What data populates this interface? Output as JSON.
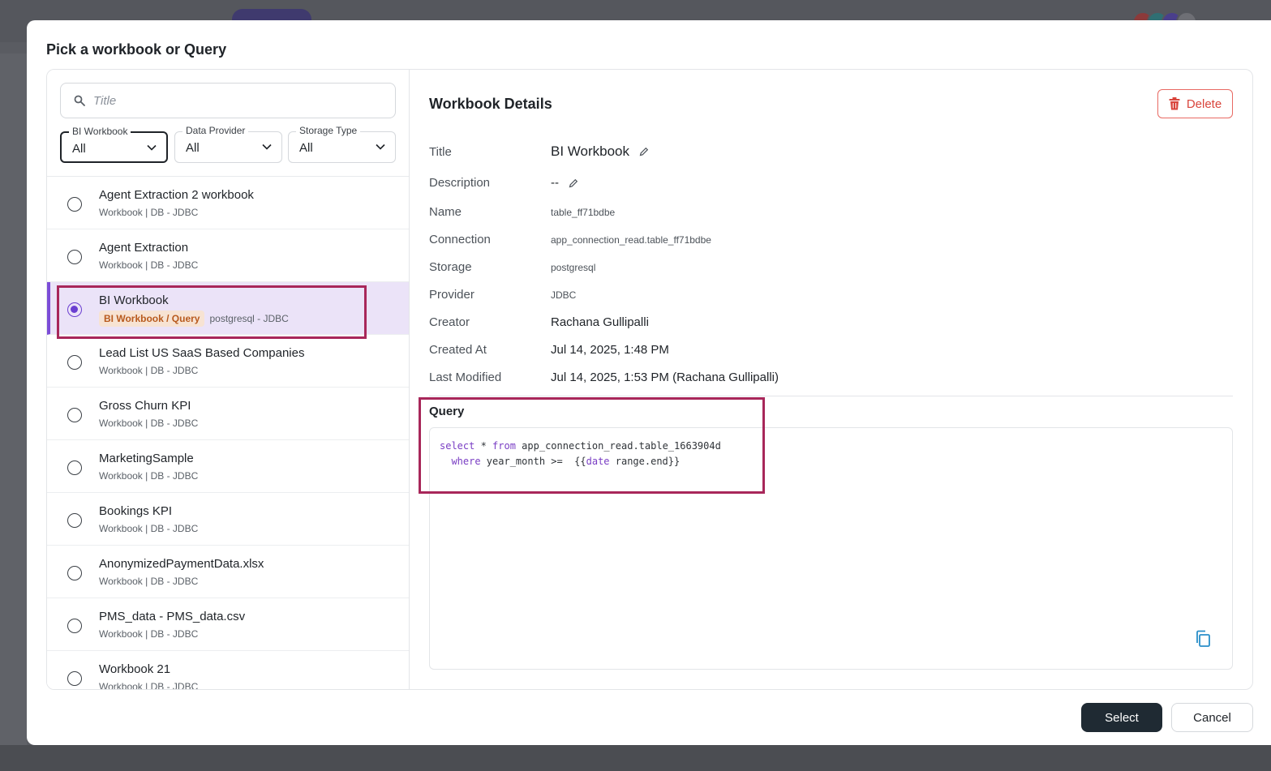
{
  "modal": {
    "title": "Pick a workbook or Query"
  },
  "search": {
    "placeholder": "Title",
    "icon": "search-icon"
  },
  "filters": [
    {
      "label": "BI Workbook",
      "value": "All"
    },
    {
      "label": "Data Provider",
      "value": "All"
    },
    {
      "label": "Storage Type",
      "value": "All"
    }
  ],
  "list": {
    "items": [
      {
        "title": "Agent Extraction 2 workbook",
        "subtitle": "Workbook | DB - JDBC"
      },
      {
        "title": "Agent Extraction",
        "subtitle": "Workbook | DB - JDBC"
      },
      {
        "title": "BI Workbook",
        "badge": "BI Workbook / Query",
        "subtitle": "postgresql - JDBC",
        "selected": true
      },
      {
        "title": "Lead List US SaaS Based Companies",
        "subtitle": "Workbook | DB - JDBC"
      },
      {
        "title": "Gross Churn KPI",
        "subtitle": "Workbook | DB - JDBC"
      },
      {
        "title": "MarketingSample",
        "subtitle": "Workbook | DB - JDBC"
      },
      {
        "title": "Bookings KPI",
        "subtitle": "Workbook | DB - JDBC"
      },
      {
        "title": "AnonymizedPaymentData.xlsx",
        "subtitle": "Workbook | DB - JDBC"
      },
      {
        "title": "PMS_data - PMS_data.csv",
        "subtitle": "Workbook | DB - JDBC"
      },
      {
        "title": "Workbook 21",
        "subtitle": "Workbook | DB - JDBC"
      }
    ]
  },
  "details": {
    "heading": "Workbook Details",
    "delete_label": "Delete",
    "fields": {
      "title": {
        "label": "Title",
        "value": "BI Workbook"
      },
      "description": {
        "label": "Description",
        "value": "--"
      },
      "name": {
        "label": "Name",
        "value": "table_ff71bdbe"
      },
      "connection": {
        "label": "Connection",
        "value": "app_connection_read.table_ff71bdbe"
      },
      "storage": {
        "label": "Storage",
        "value": "postgresql"
      },
      "provider": {
        "label": "Provider",
        "value": "JDBC"
      },
      "creator": {
        "label": "Creator",
        "value": "Rachana Gullipalli"
      },
      "created_at": {
        "label": "Created At",
        "value": "Jul 14, 2025, 1:48 PM"
      },
      "last_modified": {
        "label": "Last Modified",
        "value": "Jul 14, 2025, 1:53 PM (Rachana Gullipalli)"
      }
    },
    "query": {
      "label": "Query",
      "line1": {
        "kw1": "select",
        "op": " * ",
        "kw2": "from",
        "rest": " app_connection_read.table_1663904d"
      },
      "line2": {
        "indent": "  ",
        "kw1": "where",
        "mid": " year_month >=  {{",
        "kw2": "date",
        "rest": " range.end}}"
      }
    }
  },
  "footer": {
    "select_label": "Select",
    "cancel_label": "Cancel"
  },
  "colors": {
    "accent": "#7c4dd8",
    "danger": "#d9453c",
    "highlight": "#a8275a",
    "primary_button": "#1f2a33"
  }
}
